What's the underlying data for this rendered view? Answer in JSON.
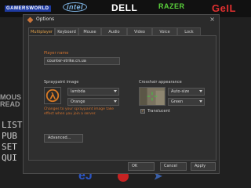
{
  "sponsors": {
    "gamers": "GAMERSWORLD",
    "intel": "intel",
    "dell": "DELL",
    "razer": "RAZER",
    "geil": "GeIL"
  },
  "background": {
    "side_title_lines": [
      "MOUS",
      "READ"
    ],
    "menu_items": [
      "LIST",
      "PUB",
      "SET",
      "QUI"
    ]
  },
  "dialog": {
    "title": "Options",
    "tabs": [
      "Multiplayer",
      "Keyboard",
      "Mouse",
      "Audio",
      "Video",
      "Voice",
      "Lock"
    ],
    "active_tab": "Multiplayer",
    "player_name_label": "Player name",
    "player_name_value": "counter-strike.cn.ua",
    "spraypaint_label": "Spraypaint image",
    "spray_image_value": "lambda",
    "spray_color_value": "Orange",
    "spray_hint": "Changes to your spraypaint image take effect when you join a server.",
    "crosshair_label": "Crosshair appearance",
    "crosshair_size_value": "Auto-size",
    "crosshair_color_value": "Green",
    "translucent_label": "Translucent",
    "translucent_checked": true,
    "advanced_button": "Advanced...",
    "ok_button": "OK",
    "cancel_button": "Cancel",
    "apply_button": "Apply"
  },
  "colors": {
    "accent_orange": "#d4732e",
    "active_tab_text": "#e0a04a",
    "dialog_bg": "#2b2b2b"
  }
}
